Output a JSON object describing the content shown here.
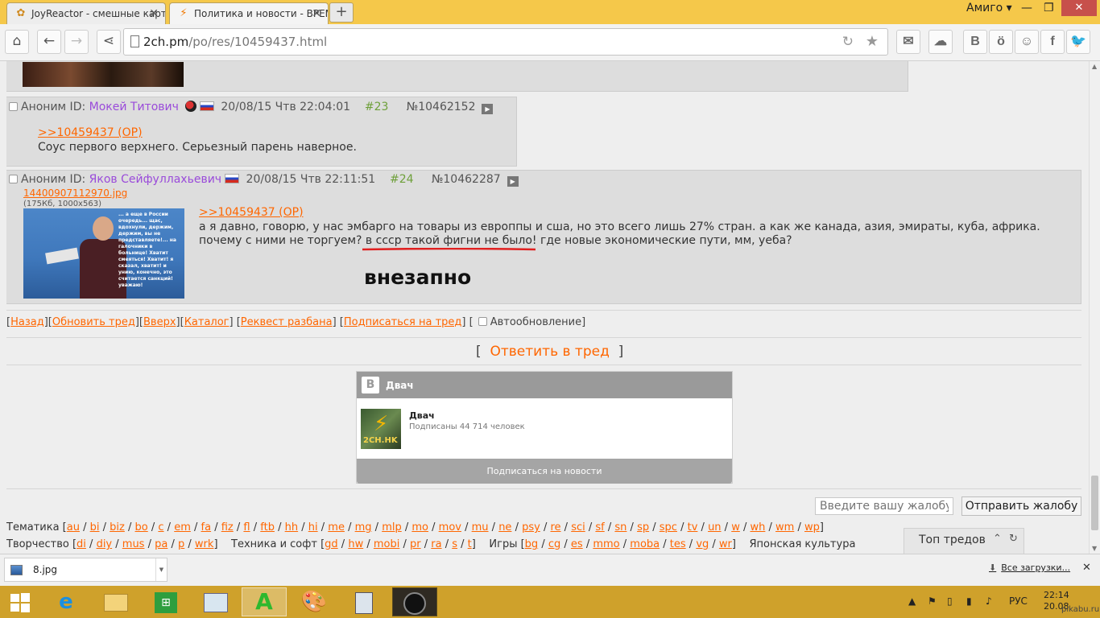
{
  "browser": {
    "tabs": [
      {
        "title": "JoyReactor - смешные карт",
        "active": false
      },
      {
        "title": "Политика и новости - ВРЕМ",
        "active": true
      }
    ],
    "profile": "Амиго",
    "url_host": "2ch.pm",
    "url_path": "/po/res/10459437.html"
  },
  "posts": [
    {
      "author_prefix": "Аноним ID:",
      "name": "Мокей Титович",
      "date": "20/08/15 Чтв 22:04:01",
      "number": "#23",
      "post_id": "№10462152",
      "reply_link": ">>10459437 (OP)",
      "text": "Соус первого верхнего. Серьезный парень наверное."
    },
    {
      "author_prefix": "Аноним ID:",
      "name": "Яков Сейфуллахьевич",
      "date": "20/08/15 Чтв 22:11:51",
      "number": "#24",
      "post_id": "№10462287",
      "file_name": "14400907112970.jpg",
      "file_info": "(175Кб, 1000x563)",
      "image_caption": "... а еще в России очередь... щас, вдохнули, держим, держим, вы не представляете!... на галочники в больнице! Хватит смеяться! Хватит! я сказал, хватит! и унию, конечно, это считается санкций! уважаю!",
      "reply_link": ">>10459437 (OP)",
      "text_line1": "а я давно, говорю, у нас эмбарго на товары из европпы и сша, но это всего лишь 27% стран. а как же канада, азия, эмираты, куба, африка.",
      "text_line2": "почему с ними не торгуем? в ссср такой фигни не было! где новые экономические пути, мм, уеба?",
      "annotation": "внезапно"
    }
  ],
  "thread_nav": {
    "back": "Назад",
    "refresh": "Обновить тред",
    "top": "Вверх",
    "catalog": "Каталог",
    "unban": "Реквест разбана",
    "subscribe": "Подписаться на тред",
    "autorefresh": "Автообновление"
  },
  "reply_button": "Ответить в тред",
  "vk_widget": {
    "header": "Двач",
    "logo": "B",
    "group_name": "Двач",
    "subscribers": "Подписаны 44 714 человек",
    "avatar_tag": "2CH.HK",
    "subscribe_button": "Подписаться на новости"
  },
  "complaint": {
    "placeholder": "Введите вашу жалобу",
    "button": "Отправить жалобу"
  },
  "boards": {
    "themes_label": "Тематика",
    "themes": [
      "au",
      "bi",
      "biz",
      "bo",
      "c",
      "em",
      "fa",
      "fiz",
      "fl",
      "ftb",
      "hh",
      "hi",
      "me",
      "mg",
      "mlp",
      "mo",
      "mov",
      "mu",
      "ne",
      "psy",
      "re",
      "sci",
      "sf",
      "sn",
      "sp",
      "spc",
      "tv",
      "un",
      "w",
      "wh",
      "wm",
      "wp"
    ],
    "creative_label": "Творчество",
    "creative": [
      "di",
      "diy",
      "mus",
      "pa",
      "p",
      "wrk"
    ],
    "tech_label": "Техника и софт",
    "tech": [
      "gd",
      "hw",
      "mobi",
      "pr",
      "ra",
      "s",
      "t"
    ],
    "games_label": "Игры",
    "games": [
      "bg",
      "cg",
      "es",
      "mmo",
      "moba",
      "tes",
      "vg",
      "wr"
    ],
    "japanese_label": "Японская культура"
  },
  "top_threads": "Топ тредов",
  "downloads": {
    "file": "8.jpg",
    "all": "Все загрузки..."
  },
  "taskbar": {
    "lang": "РУС",
    "time": "22:14",
    "date": "20.08",
    "watermark": "pikabu.ru"
  }
}
